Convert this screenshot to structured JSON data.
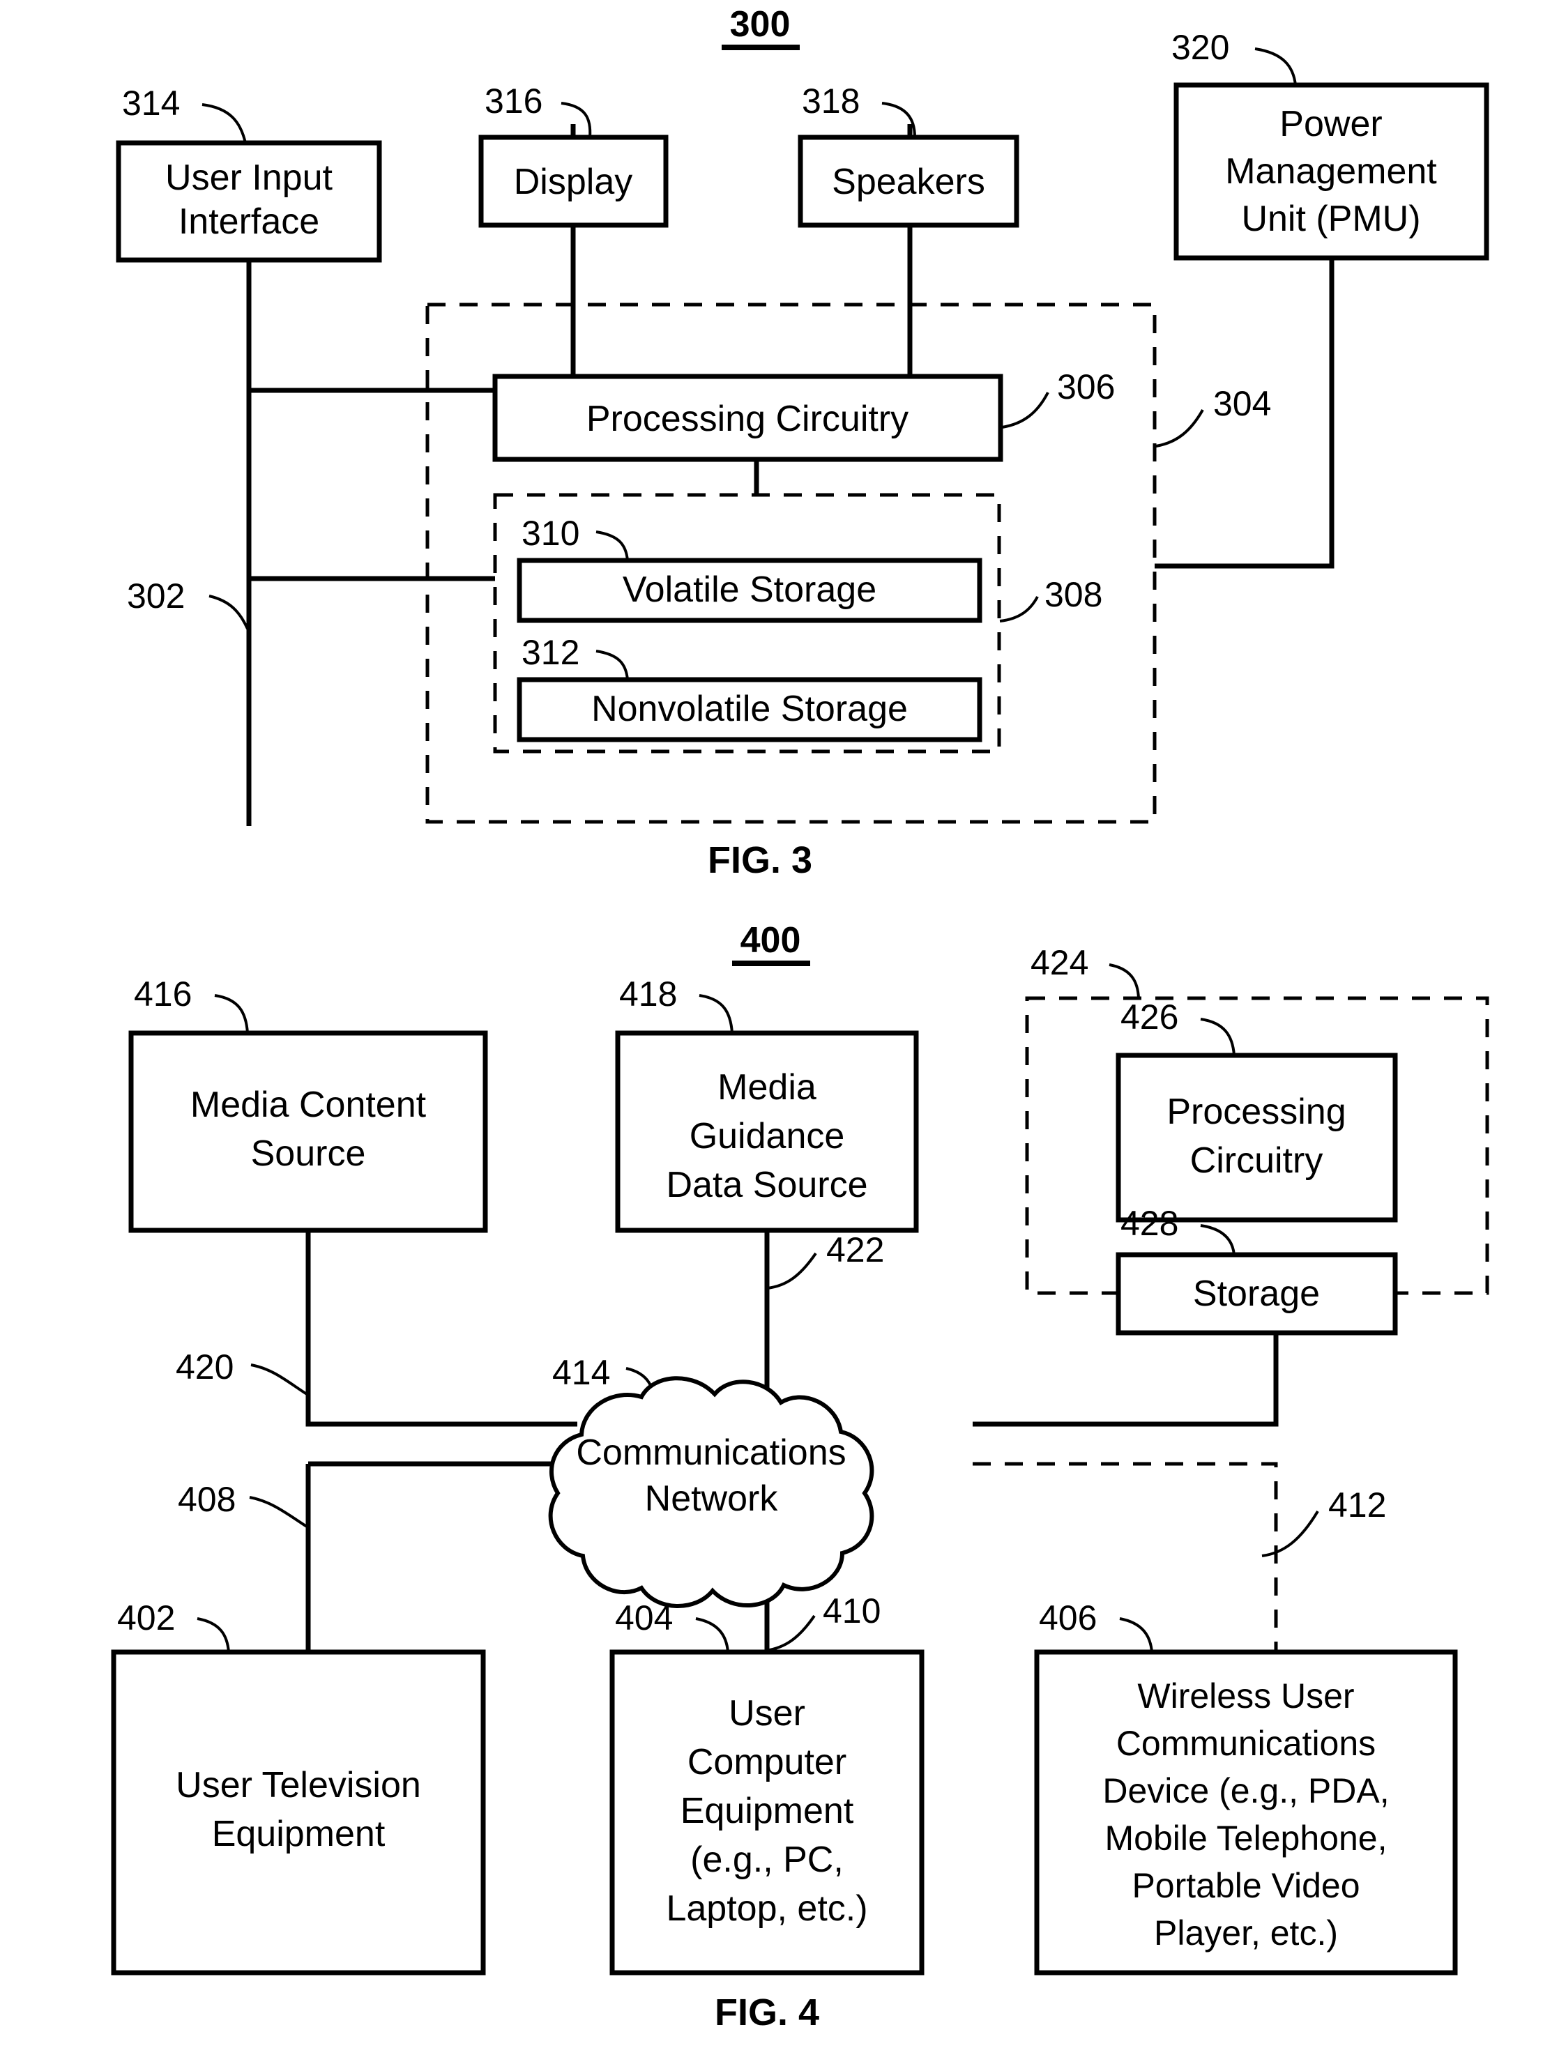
{
  "figures": [
    {
      "id": "fig3",
      "number_tag": "300",
      "caption": "FIG. 3",
      "refs": {
        "device": "302",
        "control_circuitry": "304",
        "processing_circuitry": "306",
        "storage": "308",
        "volatile_storage": "310",
        "nonvolatile_storage": "312",
        "user_input_interface": "314",
        "display": "316",
        "speakers": "318",
        "pmu": "320"
      },
      "boxes": {
        "user_input_interface": {
          "label_line1": "User Input",
          "label_line2": "Interface"
        },
        "display": {
          "label_line1": "Display"
        },
        "speakers": {
          "label_line1": "Speakers"
        },
        "pmu": {
          "label_line1": "Power",
          "label_line2": "Management",
          "label_line3": "Unit (PMU)"
        },
        "processing_circuitry": {
          "label_line1": "Processing Circuitry"
        },
        "volatile_storage": {
          "label_line1": "Volatile Storage"
        },
        "nonvolatile_storage": {
          "label_line1": "Nonvolatile Storage"
        }
      }
    },
    {
      "id": "fig4",
      "number_tag": "400",
      "caption": "FIG. 4",
      "refs": {
        "user_television_equipment": "402",
        "user_computer_equipment": "404",
        "wireless_user_communications_device": "406",
        "path_tv": "408",
        "path_computer": "410",
        "path_wireless": "412",
        "communications_network": "414",
        "media_content_source": "416",
        "media_guidance_data_source": "418",
        "path_media_content": "420",
        "path_guidance_data": "422",
        "server": "424",
        "server_processing_circuitry": "426",
        "server_storage": "428"
      },
      "boxes": {
        "media_content_source": {
          "label_line1": "Media Content",
          "label_line2": "Source"
        },
        "media_guidance_data_source": {
          "label_line1": "Media",
          "label_line2": "Guidance",
          "label_line3": "Data Source"
        },
        "server_processing_circuitry": {
          "label_line1": "Processing",
          "label_line2": "Circuitry"
        },
        "server_storage": {
          "label_line1": "Storage"
        },
        "communications_network": {
          "label_line1": "Communications",
          "label_line2": "Network"
        },
        "user_television_equipment": {
          "label_line1": "User Television",
          "label_line2": "Equipment"
        },
        "user_computer_equipment": {
          "label_line1": "User",
          "label_line2": "Computer",
          "label_line3": "Equipment",
          "label_line4": "(e.g., PC,",
          "label_line5": "Laptop, etc.)"
        },
        "wireless_user_communications_device": {
          "label_line1": "Wireless User",
          "label_line2": "Communications",
          "label_line3": "Device (e.g., PDA,",
          "label_line4": "Mobile Telephone,",
          "label_line5": "Portable Video",
          "label_line6": "Player, etc.)"
        }
      }
    }
  ],
  "colors": {
    "ink": "#000000",
    "paper": "#ffffff"
  }
}
